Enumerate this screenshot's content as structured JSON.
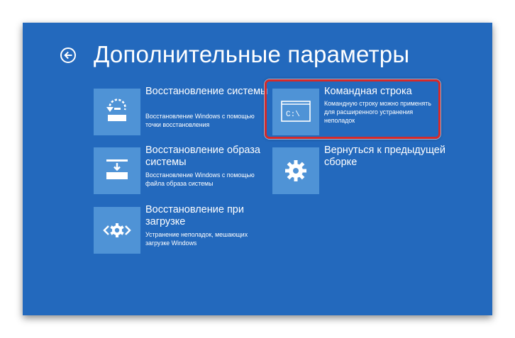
{
  "page": {
    "title": "Дополнительные параметры",
    "background_color": "#2369bd",
    "tile_color": "#4f93d6",
    "highlight_color": "#d42a2a",
    "back_icon": "back-arrow-icon"
  },
  "options": [
    {
      "title": "Восстановление системы",
      "desc": "Восстановление Windows с помощью точки восстановления",
      "icon": "system-restore-icon"
    },
    {
      "title": "Восстановление образа системы",
      "desc": "Восстановление Windows с помощью файла образа системы",
      "icon": "image-recovery-icon"
    },
    {
      "title": "Восстановление при загрузке",
      "desc": "Устранение неполадок, мешающих загрузке Windows",
      "icon": "startup-repair-icon"
    },
    {
      "title": "Командная строка",
      "desc": "Командную строку можно применять для расширенного устранения неполадок",
      "icon": "command-prompt-icon",
      "icon_text": "C:\\",
      "highlighted": true
    },
    {
      "title": "Вернуться к предыдущей сборке",
      "desc": "",
      "icon": "gear-icon"
    }
  ]
}
